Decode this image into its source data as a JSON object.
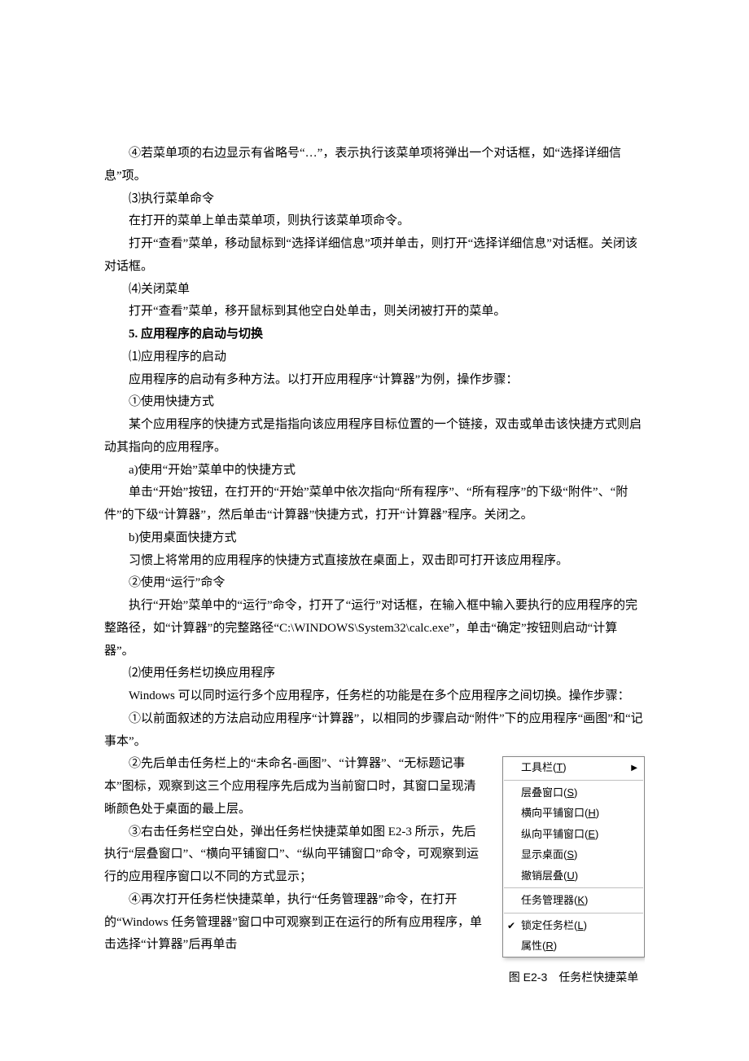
{
  "p1": "④若菜单项的右边显示有省略号“…”，表示执行该菜单项将弹出一个对话框，如“选择详细信息”项。",
  "p2": "⑶执行菜单命令",
  "p3": "在打开的菜单上单击菜单项，则执行该菜单项命令。",
  "p4": "打开“查看”菜单，移动鼠标到“选择详细信息”项并单击，则打开“选择详细信息”对话框。关闭该对话框。",
  "p5": "⑷关闭菜单",
  "p6": "打开“查看”菜单，移开鼠标到其他空白处单击，则关闭被打开的菜单。",
  "h5": "5. 应用程序的启动与切换",
  "p7": "⑴应用程序的启动",
  "p8": "应用程序的启动有多种方法。以打开应用程序“计算器”为例，操作步骤：",
  "p9": "①使用快捷方式",
  "p10": "某个应用程序的快捷方式是指指向该应用程序目标位置的一个链接，双击或单击该快捷方式则启动其指向的应用程序。",
  "p11": "a)使用“开始”菜单中的快捷方式",
  "p12": "单击“开始”按钮，在打开的“开始”菜单中依次指向“所有程序”、“所有程序”的下级“附件”、“附件”的下级“计算器”，然后单击“计算器”快捷方式，打开“计算器”程序。关闭之。",
  "p13": "b)使用桌面快捷方式",
  "p14": "习惯上将常用的应用程序的快捷方式直接放在桌面上，双击即可打开该应用程序。",
  "p15": "②使用“运行”命令",
  "p16": "执行“开始”菜单中的“运行”命令，打开了“运行”对话框，在输入框中输入要执行的应用程序的完整路径，如“计算器”的完整路径“C:\\WINDOWS\\System32\\calc.exe”，单击“确定”按钮则启动“计算器”。",
  "p17": "⑵使用任务栏切换应用程序",
  "p18": "Windows 可以同时运行多个应用程序，任务栏的功能是在多个应用程序之间切换。操作步骤：",
  "p19": "①以前面叙述的方法启动应用程序“计算器”，以相同的步骤启动“附件”下的应用程序“画图”和“记事本”。",
  "p20": "②先后单击任务栏上的“未命名-画图”、“计算器”、“无标题记事本”图标，观察到这三个应用程序先后成为当前窗口时，其窗口呈现清晰颜色处于桌面的最上层。",
  "p21": "③右击任务栏空白处，弹出任务栏快捷菜单如图 E2-3 所示，先后执行“层叠窗口”、“横向平铺窗口”、“纵向平铺窗口”命令，可观察到运行的应用程序窗口以不同的方式显示；",
  "p22": "④再次打开任务栏快捷菜单，执行“任务管理器”命令，在打开的“Windows 任务管理器”窗口中可观察到正在运行的所有应用程序，单击选择“计算器”后再单击",
  "menu": {
    "toolbar": {
      "t": "工具栏(",
      "k": "T",
      "s": ")"
    },
    "cascade": {
      "t": "层叠窗口(",
      "k": "S",
      "s": ")"
    },
    "tileh": {
      "t": "横向平铺窗口(",
      "k": "H",
      "s": ")"
    },
    "tilev": {
      "t": "纵向平铺窗口(",
      "k": "E",
      "s": ")"
    },
    "desktop": {
      "t": "显示桌面(",
      "k": "S",
      "s": ")"
    },
    "undo": {
      "t": "撤销层叠(",
      "k": "U",
      "s": ")"
    },
    "taskmgr": {
      "t": "任务管理器(",
      "k": "K",
      "s": ")"
    },
    "lock": {
      "t": "锁定任务栏(",
      "k": "L",
      "s": ")"
    },
    "prop": {
      "t": "属性(",
      "k": "R",
      "s": ")"
    }
  },
  "caption": "图 E2-3　任务栏快捷菜单"
}
